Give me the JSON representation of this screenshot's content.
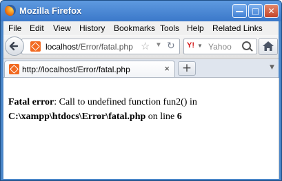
{
  "window": {
    "title": "Mozilla Firefox",
    "minimize_glyph": "—",
    "maximize_glyph": "□",
    "close_glyph": "✕"
  },
  "menu": {
    "items": [
      "File",
      "Edit",
      "View",
      "History",
      "Bookmarks",
      "Tools",
      "Help",
      "Related Links"
    ]
  },
  "urlbar": {
    "host": "localhost",
    "path": "/Error/fatal.php"
  },
  "search": {
    "placeholder": "Yahoo",
    "engine_glyph": "Y!"
  },
  "tab": {
    "title": "http://localhost/Error/fatal.php"
  },
  "page": {
    "error_label": "Fatal error",
    "message": ": Call to undefined function fun2() in ",
    "file": "C:\\xampp\\htdocs\\Error\\fatal.php",
    "line_text": " on line ",
    "line_number": "6"
  },
  "colors": {
    "titlebar": "#3b78c9",
    "menubar": "#f0f0f0",
    "site_icon": "#f26a21"
  },
  "icons": [
    "firefox-logo-icon",
    "back-arrow-icon",
    "site-favicon-icon",
    "bookmark-star-icon",
    "dropdown-icon",
    "reload-icon",
    "yahoo-icon",
    "search-magnifier-icon",
    "home-icon",
    "tab-close-icon",
    "new-tab-icon",
    "tab-list-icon"
  ]
}
